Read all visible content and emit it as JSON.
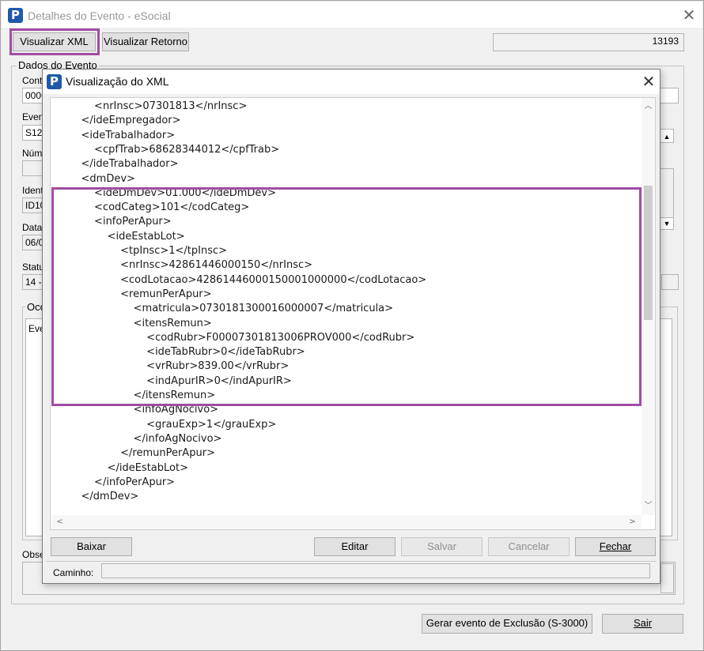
{
  "main": {
    "title": "Detalhes do Evento - eSocial",
    "close_glyph": "✕",
    "btn_visualizar_xml": "Visualizar XML",
    "btn_visualizar_retorno": "Visualizar Retorno",
    "counter_value": "13193",
    "group_dados_evento": "Dados do Evento",
    "lbl_contribuinte": "Contr",
    "val_contribuinte": "0006",
    "lbl_evento": "Even",
    "val_evento": "S120",
    "lbl_numero": "Núme",
    "lbl_identificador": "Ident",
    "val_identificador": "ID10",
    "lbl_data": "Data",
    "val_data": "06/0",
    "lbl_status": "Statu",
    "val_status": "14 -",
    "lbl_ocorrencias": "Oco",
    "val_ocorrencias": "Eve",
    "lbl_observacao": "Obse",
    "btn_gerar_exclusao": "Gerar evento de Exclusão (S-3000)",
    "btn_sair": "Sair"
  },
  "xml_dialog": {
    "title": "Visualização do XML",
    "close_glyph": "✕",
    "lines": [
      "        <nrInsc>07301813</nrInsc>",
      "    </ideEmpregador>",
      "    <ideTrabalhador>",
      "        <cpfTrab>68628344012</cpfTrab>",
      "    </ideTrabalhador>",
      "    <dmDev>",
      "        <ideDmDev>01.000</ideDmDev>",
      "        <codCateg>101</codCateg>",
      "        <infoPerApur>",
      "            <ideEstabLot>",
      "                <tpInsc>1</tpInsc>",
      "                <nrInsc>42861446000150</nrInsc>",
      "                <codLotacao>42861446000150001000000</codLotacao>",
      "                <remunPerApur>",
      "                    <matricula>0730181300016000007</matricula>",
      "                    <itensRemun>",
      "                        <codRubr>F00007301813006PROV000</codRubr>",
      "                        <ideTabRubr>0</ideTabRubr>",
      "                        <vrRubr>839.00</vrRubr>",
      "                        <indApurIR>0</indApurIR>",
      "                    </itensRemun>",
      "                    <infoAgNocivo>",
      "                        <grauExp>1</grauExp>",
      "                    </infoAgNocivo>",
      "                </remunPerApur>",
      "            </ideEstabLot>",
      "        </infoPerApur>",
      "    </dmDev>"
    ],
    "btn_baixar": "Baixar",
    "btn_editar": "Editar",
    "btn_salvar": "Salvar",
    "btn_cancelar": "Cancelar",
    "btn_fechar": "Fechar",
    "lbl_caminho": "Caminho:",
    "scroll_up": "︿",
    "scroll_down": "﹀",
    "scroll_left": "<",
    "scroll_right": ">"
  },
  "colors": {
    "highlight": "#a04ca4",
    "app_icon": "#1e5aa8"
  }
}
